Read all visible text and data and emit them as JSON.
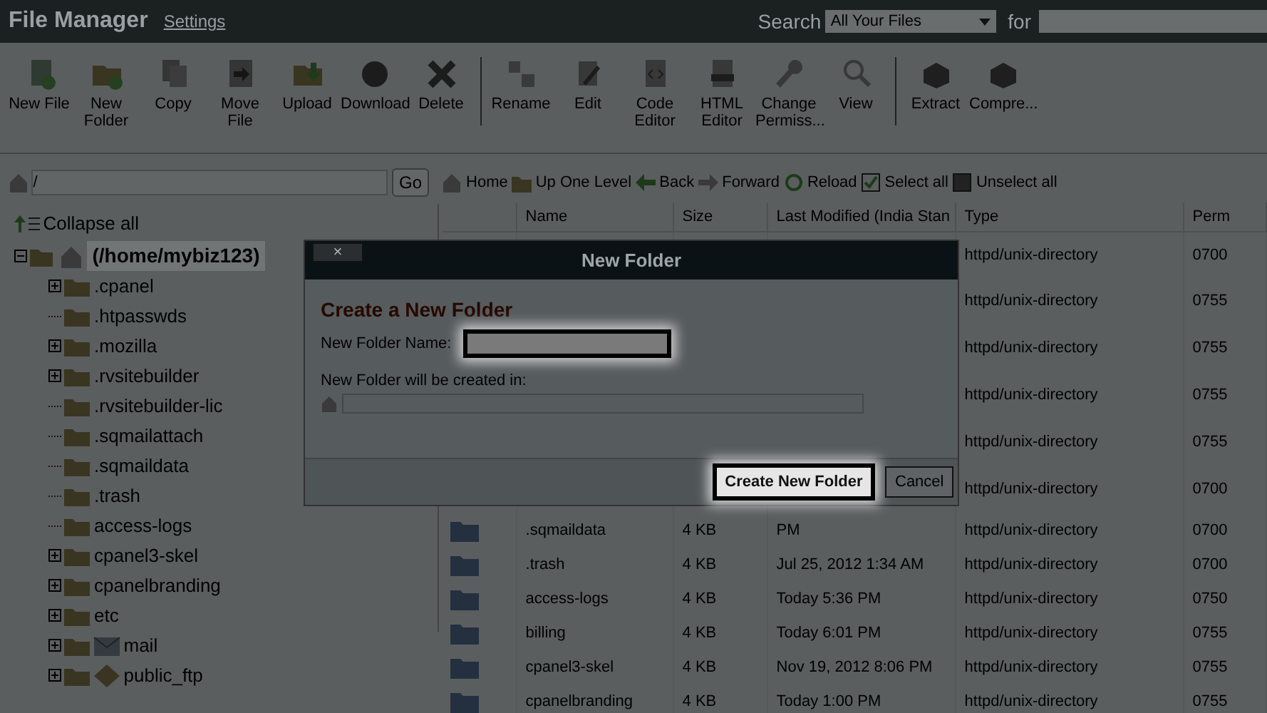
{
  "header": {
    "title": "File Manager",
    "settings_link": "Settings",
    "search_label": "Search",
    "search_scope": "All Your Files",
    "for_label": "for"
  },
  "toolbar_groups": [
    [
      {
        "label": "New File"
      },
      {
        "label": "New Folder"
      },
      {
        "label": "Copy"
      },
      {
        "label": "Move File"
      },
      {
        "label": "Upload"
      },
      {
        "label": "Download"
      },
      {
        "label": "Delete"
      }
    ],
    [
      {
        "label": "Rename"
      },
      {
        "label": "Edit"
      },
      {
        "label": "Code Editor"
      },
      {
        "label": "HTML Editor"
      },
      {
        "label": "Change Permiss..."
      },
      {
        "label": "View"
      }
    ],
    [
      {
        "label": "Extract"
      },
      {
        "label": "Compre..."
      }
    ]
  ],
  "path_bar": {
    "value": "/",
    "go_button": "Go"
  },
  "tree": {
    "collapse_all": "Collapse all",
    "root": {
      "label": "(/home/mybiz123)",
      "expanded": true,
      "selected": true,
      "children": [
        {
          "label": ".cpanel",
          "expandable": true,
          "kind": "folder"
        },
        {
          "label": ".htpasswds",
          "expandable": false,
          "kind": "folder"
        },
        {
          "label": ".mozilla",
          "expandable": true,
          "kind": "folder"
        },
        {
          "label": ".rvsitebuilder",
          "expandable": true,
          "kind": "folder"
        },
        {
          "label": ".rvsitebuilder-lic",
          "expandable": false,
          "kind": "folder"
        },
        {
          "label": ".sqmailattach",
          "expandable": false,
          "kind": "folder"
        },
        {
          "label": ".sqmaildata",
          "expandable": false,
          "kind": "folder"
        },
        {
          "label": ".trash",
          "expandable": false,
          "kind": "folder"
        },
        {
          "label": "access-logs",
          "expandable": false,
          "kind": "folder"
        },
        {
          "label": "cpanel3-skel",
          "expandable": true,
          "kind": "folder"
        },
        {
          "label": "cpanelbranding",
          "expandable": true,
          "kind": "folder"
        },
        {
          "label": "etc",
          "expandable": true,
          "kind": "folder"
        },
        {
          "label": "mail",
          "expandable": true,
          "kind": "mail"
        },
        {
          "label": "public_ftp",
          "expandable": true,
          "kind": "ftp"
        }
      ]
    }
  },
  "nav": [
    {
      "label": "Home"
    },
    {
      "label": "Up One Level"
    },
    {
      "label": "Back"
    },
    {
      "label": "Forward"
    },
    {
      "label": "Reload"
    },
    {
      "label": "Select all"
    },
    {
      "label": "Unselect all"
    }
  ],
  "table": {
    "columns": [
      "Name",
      "Size",
      "Last Modified (India Stan",
      "Type",
      "Perm"
    ],
    "rows": [
      {
        "type": "httpd/unix-directory",
        "perms": "0700"
      },
      {
        "type": "httpd/unix-directory",
        "perms": "0755"
      },
      {
        "type": "httpd/unix-directory",
        "perms": "0755"
      },
      {
        "type": "httpd/unix-directory",
        "perms": "0755"
      },
      {
        "type": "httpd/unix-directory",
        "perms": "0755"
      },
      {
        "type": "httpd/unix-directory",
        "perms": "0700"
      },
      {
        "name": ".sqmaildata",
        "size": "4 KB",
        "modified": "PM",
        "type": "httpd/unix-directory",
        "perms": "0700"
      },
      {
        "name": ".trash",
        "size": "4 KB",
        "modified": "Jul 25, 2012 1:34 AM",
        "type": "httpd/unix-directory",
        "perms": "0700"
      },
      {
        "name": "access-logs",
        "size": "4 KB",
        "modified": "Today 5:36 PM",
        "type": "httpd/unix-directory",
        "perms": "0750"
      },
      {
        "name": "billing",
        "size": "4 KB",
        "modified": "Today 6:01 PM",
        "type": "httpd/unix-directory",
        "perms": "0755"
      },
      {
        "name": "cpanel3-skel",
        "size": "4 KB",
        "modified": "Nov 19, 2012 8:06 PM",
        "type": "httpd/unix-directory",
        "perms": "0755"
      },
      {
        "name": "cpanelbranding",
        "size": "4 KB",
        "modified": "Today 1:00 PM",
        "type": "httpd/unix-directory",
        "perms": "0755"
      }
    ]
  },
  "modal": {
    "title": "New Folder",
    "close": "×",
    "heading": "Create a New Folder",
    "name_label": "New Folder Name:",
    "name_highlighted": true,
    "location_label": "New Folder will be created in:",
    "create_button": "Create New Folder",
    "create_highlighted": true,
    "cancel_button": "Cancel"
  }
}
